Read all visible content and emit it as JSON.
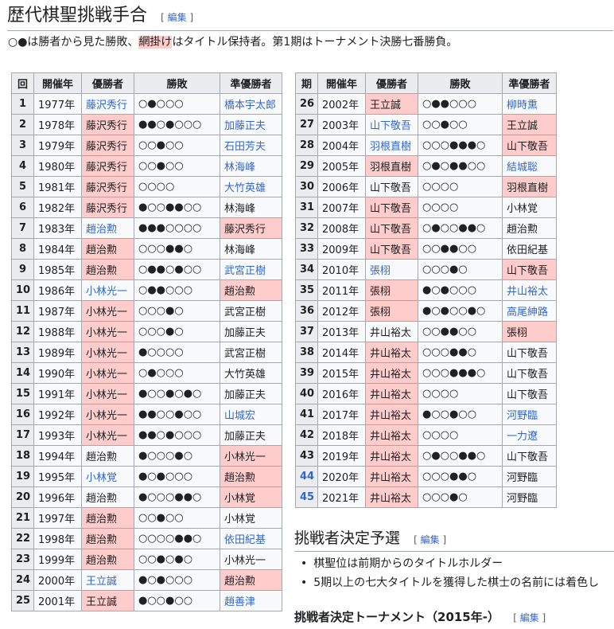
{
  "section": {
    "title": "歴代棋聖挑戦手合",
    "edit_label": "編集"
  },
  "intro": {
    "before": "○●は勝者から見た勝敗、",
    "highlight": "網掛け",
    "after": "はタイトル保持者。第1期はトーナメント決勝七番勝負。"
  },
  "table": {
    "headers": [
      "回",
      "開催年",
      "優勝者",
      "勝敗",
      "準優勝者"
    ],
    "headers_right": [
      "期",
      "開催年",
      "優勝者",
      "勝敗",
      "準優勝者"
    ],
    "rows_left": [
      {
        "n": "1",
        "year": "1977年",
        "w": "藤沢秀行",
        "r": "○●○○○",
        "l": "橋本宇太郎",
        "wh": false,
        "lh": false,
        "wl": true,
        "ll": true,
        "nl": false
      },
      {
        "n": "2",
        "year": "1978年",
        "w": "藤沢秀行",
        "r": "●●○●○○○",
        "l": "加藤正夫",
        "wh": true,
        "lh": false,
        "wl": false,
        "ll": true,
        "nl": false
      },
      {
        "n": "3",
        "year": "1979年",
        "w": "藤沢秀行",
        "r": "○○●○○",
        "l": "石田芳夫",
        "wh": true,
        "lh": false,
        "wl": false,
        "ll": true,
        "nl": false
      },
      {
        "n": "4",
        "year": "1980年",
        "w": "藤沢秀行",
        "r": "○○●○○",
        "l": "林海峰",
        "wh": true,
        "lh": false,
        "wl": false,
        "ll": true,
        "nl": false
      },
      {
        "n": "5",
        "year": "1981年",
        "w": "藤沢秀行",
        "r": "○○○○",
        "l": "大竹英雄",
        "wh": true,
        "lh": false,
        "wl": false,
        "ll": true,
        "nl": false
      },
      {
        "n": "6",
        "year": "1982年",
        "w": "藤沢秀行",
        "r": "●○○●●○○",
        "l": "林海峰",
        "wh": true,
        "lh": false,
        "wl": false,
        "ll": false,
        "nl": false
      },
      {
        "n": "7",
        "year": "1983年",
        "w": "趙治勲",
        "r": "●●●○○○○",
        "l": "藤沢秀行",
        "wh": false,
        "lh": true,
        "wl": true,
        "ll": false,
        "nl": false
      },
      {
        "n": "8",
        "year": "1984年",
        "w": "趙治勲",
        "r": "○○○●●○",
        "l": "林海峰",
        "wh": true,
        "lh": false,
        "wl": false,
        "ll": false,
        "nl": false
      },
      {
        "n": "9",
        "year": "1985年",
        "w": "趙治勲",
        "r": "○●●○●○○",
        "l": "武宮正樹",
        "wh": true,
        "lh": false,
        "wl": false,
        "ll": true,
        "nl": false
      },
      {
        "n": "10",
        "year": "1986年",
        "w": "小林光一",
        "r": "○●●○○○",
        "l": "趙治勲",
        "wh": false,
        "lh": true,
        "wl": true,
        "ll": false,
        "nl": false
      },
      {
        "n": "11",
        "year": "1987年",
        "w": "小林光一",
        "r": "○○○●○",
        "l": "武宮正樹",
        "wh": true,
        "lh": false,
        "wl": false,
        "ll": false,
        "nl": false
      },
      {
        "n": "12",
        "year": "1988年",
        "w": "小林光一",
        "r": "○○○●○",
        "l": "加藤正夫",
        "wh": true,
        "lh": false,
        "wl": false,
        "ll": false,
        "nl": false
      },
      {
        "n": "13",
        "year": "1989年",
        "w": "小林光一",
        "r": "●○○○○",
        "l": "武宮正樹",
        "wh": true,
        "lh": false,
        "wl": false,
        "ll": false,
        "nl": false
      },
      {
        "n": "14",
        "year": "1990年",
        "w": "小林光一",
        "r": "○●○○○",
        "l": "大竹英雄",
        "wh": true,
        "lh": false,
        "wl": false,
        "ll": false,
        "nl": false
      },
      {
        "n": "15",
        "year": "1991年",
        "w": "小林光一",
        "r": "●○○●○●○",
        "l": "加藤正夫",
        "wh": true,
        "lh": false,
        "wl": false,
        "ll": false,
        "nl": false
      },
      {
        "n": "16",
        "year": "1992年",
        "w": "小林光一",
        "r": "●●○○●○○",
        "l": "山城宏",
        "wh": true,
        "lh": false,
        "wl": false,
        "ll": true,
        "nl": false
      },
      {
        "n": "17",
        "year": "1993年",
        "w": "小林光一",
        "r": "●●○●○○○",
        "l": "加藤正夫",
        "wh": true,
        "lh": false,
        "wl": false,
        "ll": false,
        "nl": false
      },
      {
        "n": "18",
        "year": "1994年",
        "w": "趙治勲",
        "r": "●○○○●○",
        "l": "小林光一",
        "wh": false,
        "lh": true,
        "wl": false,
        "ll": false,
        "nl": false
      },
      {
        "n": "19",
        "year": "1995年",
        "w": "小林覚",
        "r": "●○●○○○",
        "l": "趙治勲",
        "wh": false,
        "lh": true,
        "wl": true,
        "ll": false,
        "nl": false
      },
      {
        "n": "20",
        "year": "1996年",
        "w": "趙治勲",
        "r": "●○○○●●○",
        "l": "小林覚",
        "wh": false,
        "lh": true,
        "wl": false,
        "ll": false,
        "nl": false
      },
      {
        "n": "21",
        "year": "1997年",
        "w": "趙治勲",
        "r": "○○●○○",
        "l": "小林覚",
        "wh": true,
        "lh": false,
        "wl": false,
        "ll": false,
        "nl": false
      },
      {
        "n": "22",
        "year": "1998年",
        "w": "趙治勲",
        "r": "○○○○●●○",
        "l": "依田紀基",
        "wh": true,
        "lh": false,
        "wl": false,
        "ll": true,
        "nl": false
      },
      {
        "n": "23",
        "year": "1999年",
        "w": "趙治勲",
        "r": "○○●○●○",
        "l": "小林光一",
        "wh": true,
        "lh": false,
        "wl": false,
        "ll": false,
        "nl": false
      },
      {
        "n": "24",
        "year": "2000年",
        "w": "王立誠",
        "r": "●○●○○○",
        "l": "趙治勲",
        "wh": false,
        "lh": true,
        "wl": true,
        "ll": false,
        "nl": false
      },
      {
        "n": "25",
        "year": "2001年",
        "w": "王立誠",
        "r": "●○○●○○",
        "l": "趙善津",
        "wh": true,
        "lh": false,
        "wl": false,
        "ll": true,
        "nl": false
      }
    ],
    "rows_right": [
      {
        "n": "26",
        "year": "2002年",
        "w": "王立誠",
        "r": "○●●○○○",
        "l": "柳時熏",
        "wh": true,
        "lh": false,
        "wl": false,
        "ll": true,
        "nl": false
      },
      {
        "n": "27",
        "year": "2003年",
        "w": "山下敬吾",
        "r": "○○●○○",
        "l": "王立誠",
        "wh": false,
        "lh": true,
        "wl": true,
        "ll": false,
        "nl": false
      },
      {
        "n": "28",
        "year": "2004年",
        "w": "羽根直樹",
        "r": "○○○●●●○",
        "l": "山下敬吾",
        "wh": false,
        "lh": true,
        "wl": true,
        "ll": false,
        "nl": false
      },
      {
        "n": "29",
        "year": "2005年",
        "w": "羽根直樹",
        "r": "○●○●●○○",
        "l": "結城聡",
        "wh": true,
        "lh": false,
        "wl": false,
        "ll": true,
        "nl": false
      },
      {
        "n": "30",
        "year": "2006年",
        "w": "山下敬吾",
        "r": "○○○○",
        "l": "羽根直樹",
        "wh": false,
        "lh": true,
        "wl": false,
        "ll": false,
        "nl": false
      },
      {
        "n": "31",
        "year": "2007年",
        "w": "山下敬吾",
        "r": "○○○○",
        "l": "小林覚",
        "wh": true,
        "lh": false,
        "wl": false,
        "ll": false,
        "nl": false
      },
      {
        "n": "32",
        "year": "2008年",
        "w": "山下敬吾",
        "r": "○●○○●●○",
        "l": "趙治勲",
        "wh": true,
        "lh": false,
        "wl": false,
        "ll": false,
        "nl": false
      },
      {
        "n": "33",
        "year": "2009年",
        "w": "山下敬吾",
        "r": "○○●●○○",
        "l": "依田紀基",
        "wh": true,
        "lh": false,
        "wl": false,
        "ll": false,
        "nl": false
      },
      {
        "n": "34",
        "year": "2010年",
        "w": "張栩",
        "r": "○○○●○",
        "l": "山下敬吾",
        "wh": false,
        "lh": true,
        "wl": true,
        "ll": false,
        "nl": false
      },
      {
        "n": "35",
        "year": "2011年",
        "w": "張栩",
        "r": "●○●○○○",
        "l": "井山裕太",
        "wh": true,
        "lh": false,
        "wl": false,
        "ll": true,
        "nl": false
      },
      {
        "n": "36",
        "year": "2012年",
        "w": "張栩",
        "r": "●○●○○●○",
        "l": "高尾紳路",
        "wh": true,
        "lh": false,
        "wl": false,
        "ll": true,
        "nl": false
      },
      {
        "n": "37",
        "year": "2013年",
        "w": "井山裕太",
        "r": "○○●●○○",
        "l": "張栩",
        "wh": false,
        "lh": true,
        "wl": false,
        "ll": false,
        "nl": false
      },
      {
        "n": "38",
        "year": "2014年",
        "w": "井山裕太",
        "r": "○○○●●○",
        "l": "山下敬吾",
        "wh": true,
        "lh": false,
        "wl": false,
        "ll": false,
        "nl": false
      },
      {
        "n": "39",
        "year": "2015年",
        "w": "井山裕太",
        "r": "○○○●●●○",
        "l": "山下敬吾",
        "wh": true,
        "lh": false,
        "wl": false,
        "ll": false,
        "nl": false
      },
      {
        "n": "40",
        "year": "2016年",
        "w": "井山裕太",
        "r": "○○○○",
        "l": "山下敬吾",
        "wh": true,
        "lh": false,
        "wl": false,
        "ll": false,
        "nl": false
      },
      {
        "n": "41",
        "year": "2017年",
        "w": "井山裕太",
        "r": "●○○●○○",
        "l": "河野臨",
        "wh": true,
        "lh": false,
        "wl": false,
        "ll": true,
        "nl": false
      },
      {
        "n": "42",
        "year": "2018年",
        "w": "井山裕太",
        "r": "○○○○",
        "l": "一力遼",
        "wh": true,
        "lh": false,
        "wl": false,
        "ll": true,
        "nl": false
      },
      {
        "n": "43",
        "year": "2019年",
        "w": "井山裕太",
        "r": "○●○○●●○",
        "l": "山下敬吾",
        "wh": true,
        "lh": false,
        "wl": false,
        "ll": false,
        "nl": false
      },
      {
        "n": "44",
        "year": "2020年",
        "w": "井山裕太",
        "r": "○○○●●○",
        "l": "河野臨",
        "wh": true,
        "lh": false,
        "wl": false,
        "ll": false,
        "nl": true
      },
      {
        "n": "45",
        "year": "2021年",
        "w": "井山裕太",
        "r": "○○○●○",
        "l": "河野臨",
        "wh": true,
        "lh": false,
        "wl": false,
        "ll": false,
        "nl": true
      }
    ]
  },
  "challenger_section": {
    "title": "挑戦者決定予選",
    "edit_label": "編集",
    "bullets": [
      "棋聖位は前期からのタイトルホルダー",
      "5期以上の七大タイトルを獲得した棋士の名前には着色し"
    ]
  },
  "tournament_section": {
    "title": "挑戦者決定トーナメント（2015年-）",
    "edit_label": "編集"
  },
  "colors": {
    "holder_highlight": "#ffcccc",
    "header_bg": "#eaecf0",
    "link": "#3366cc",
    "border": "#a2a9b1"
  }
}
